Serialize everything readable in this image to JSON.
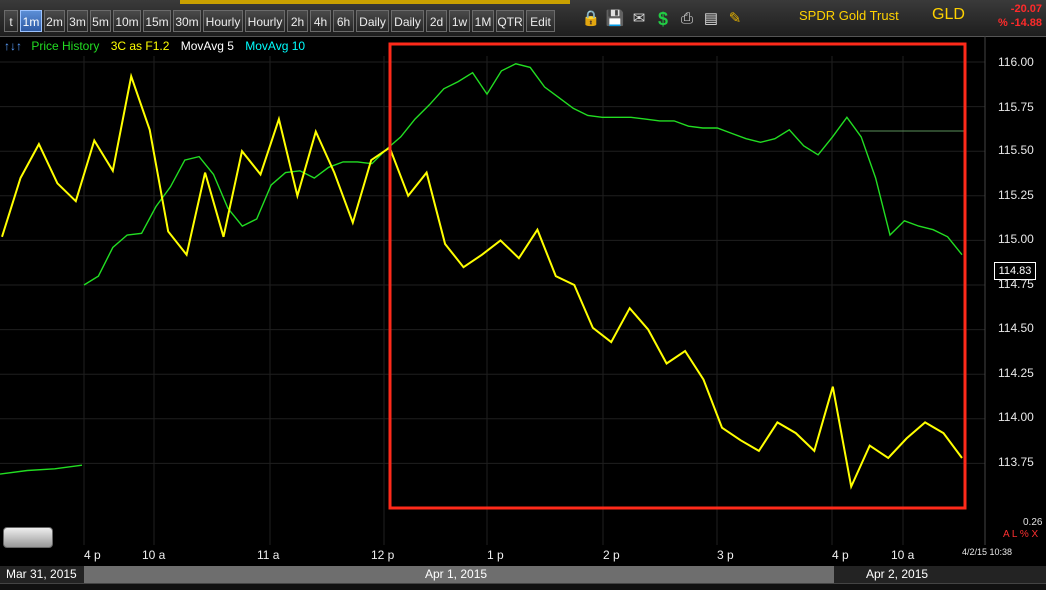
{
  "toolbar": {
    "buttons": [
      "t",
      "1m",
      "2m",
      "3m",
      "5m",
      "10m",
      "15m",
      "30m",
      "Hourly",
      "Hourly",
      "2h",
      "4h",
      "6h",
      "Daily",
      "Daily",
      "2d",
      "1w",
      "1M",
      "QTR",
      "Edit"
    ],
    "active_index": 1,
    "icons": [
      "lock-icon",
      "save-icon",
      "mail-icon",
      "dollar-icon",
      "print-icon",
      "scan-icon",
      "pencil-icon"
    ]
  },
  "header": {
    "company": "SPDR Gold Trust",
    "symbol": "GLD",
    "change_abs": "-20.07",
    "change_pct": "% -14.88"
  },
  "legend": {
    "arrows": "↑↓↑",
    "items": [
      {
        "label": "Price History",
        "color": "#22dd22"
      },
      {
        "label": "3C as F1.2",
        "color": "#ffff00"
      },
      {
        "label": "MovAvg 5",
        "color": "#ffffff"
      },
      {
        "label": "MovAvg 10",
        "color": "#00ffff"
      }
    ]
  },
  "price_label": "114.83",
  "y_axis": [
    "116.00",
    "115.75",
    "115.50",
    "115.25",
    "115.00",
    "114.75",
    "114.50",
    "114.25",
    "114.00",
    "113.75"
  ],
  "x_axis": [
    "4 p",
    "10 a",
    "11 a",
    "12 p",
    "1 p",
    "2 p",
    "3 p",
    "4 p",
    "10 a"
  ],
  "dates": [
    "Mar 31, 2015",
    "Apr 1, 2015",
    "Apr 2, 2015"
  ],
  "timestamp": "4/2/15 10:38",
  "indicator_value": "0.26",
  "axis_controls": "A L % X",
  "colors": {
    "price": "#22dd22",
    "three_c": "#ffff00",
    "highlight": "#ff2a1a",
    "accent": "#ffd200",
    "negative": "#ff2a2a"
  },
  "chart_data": {
    "type": "line",
    "title": "",
    "ylim": [
      113.5,
      116.1
    ],
    "series": [
      {
        "name": "Price History",
        "values": [
          113.69,
          113.71,
          113.72,
          113.74,
          114.75,
          114.8,
          114.96,
          115.03,
          115.04,
          115.19,
          115.3,
          115.45,
          115.47,
          115.37,
          115.18,
          115.08,
          115.12,
          115.31,
          115.38,
          115.39,
          115.35,
          115.41,
          115.44,
          115.44,
          115.43,
          115.51,
          115.58,
          115.68,
          115.76,
          115.85,
          115.89,
          115.94,
          115.82,
          115.95,
          115.99,
          115.97,
          115.86,
          115.8,
          115.74,
          115.7,
          115.69,
          115.69,
          115.69,
          115.68,
          115.67,
          115.67,
          115.64,
          115.63,
          115.63,
          115.6,
          115.57,
          115.55,
          115.57,
          115.62,
          115.53,
          115.48,
          115.58,
          115.69,
          115.58,
          115.35,
          115.03,
          115.11,
          115.08,
          115.06,
          115.02,
          114.92
        ]
      },
      {
        "name": "3C as F1.2",
        "values": [
          115.02,
          115.35,
          115.54,
          115.32,
          115.22,
          115.56,
          115.39,
          115.92,
          115.62,
          115.05,
          114.92,
          115.38,
          115.02,
          115.5,
          115.37,
          115.68,
          115.25,
          115.61,
          115.38,
          115.1,
          115.45,
          115.52,
          115.25,
          115.38,
          114.98,
          114.85,
          114.92,
          115.0,
          114.9,
          115.06,
          114.8,
          114.75,
          114.51,
          114.43,
          114.62,
          114.5,
          114.31,
          114.38,
          114.22,
          113.95,
          113.88,
          113.82,
          113.98,
          113.92,
          113.82,
          114.18,
          113.62,
          113.85,
          113.78,
          113.89,
          113.98,
          113.92,
          113.78
        ]
      }
    ]
  }
}
